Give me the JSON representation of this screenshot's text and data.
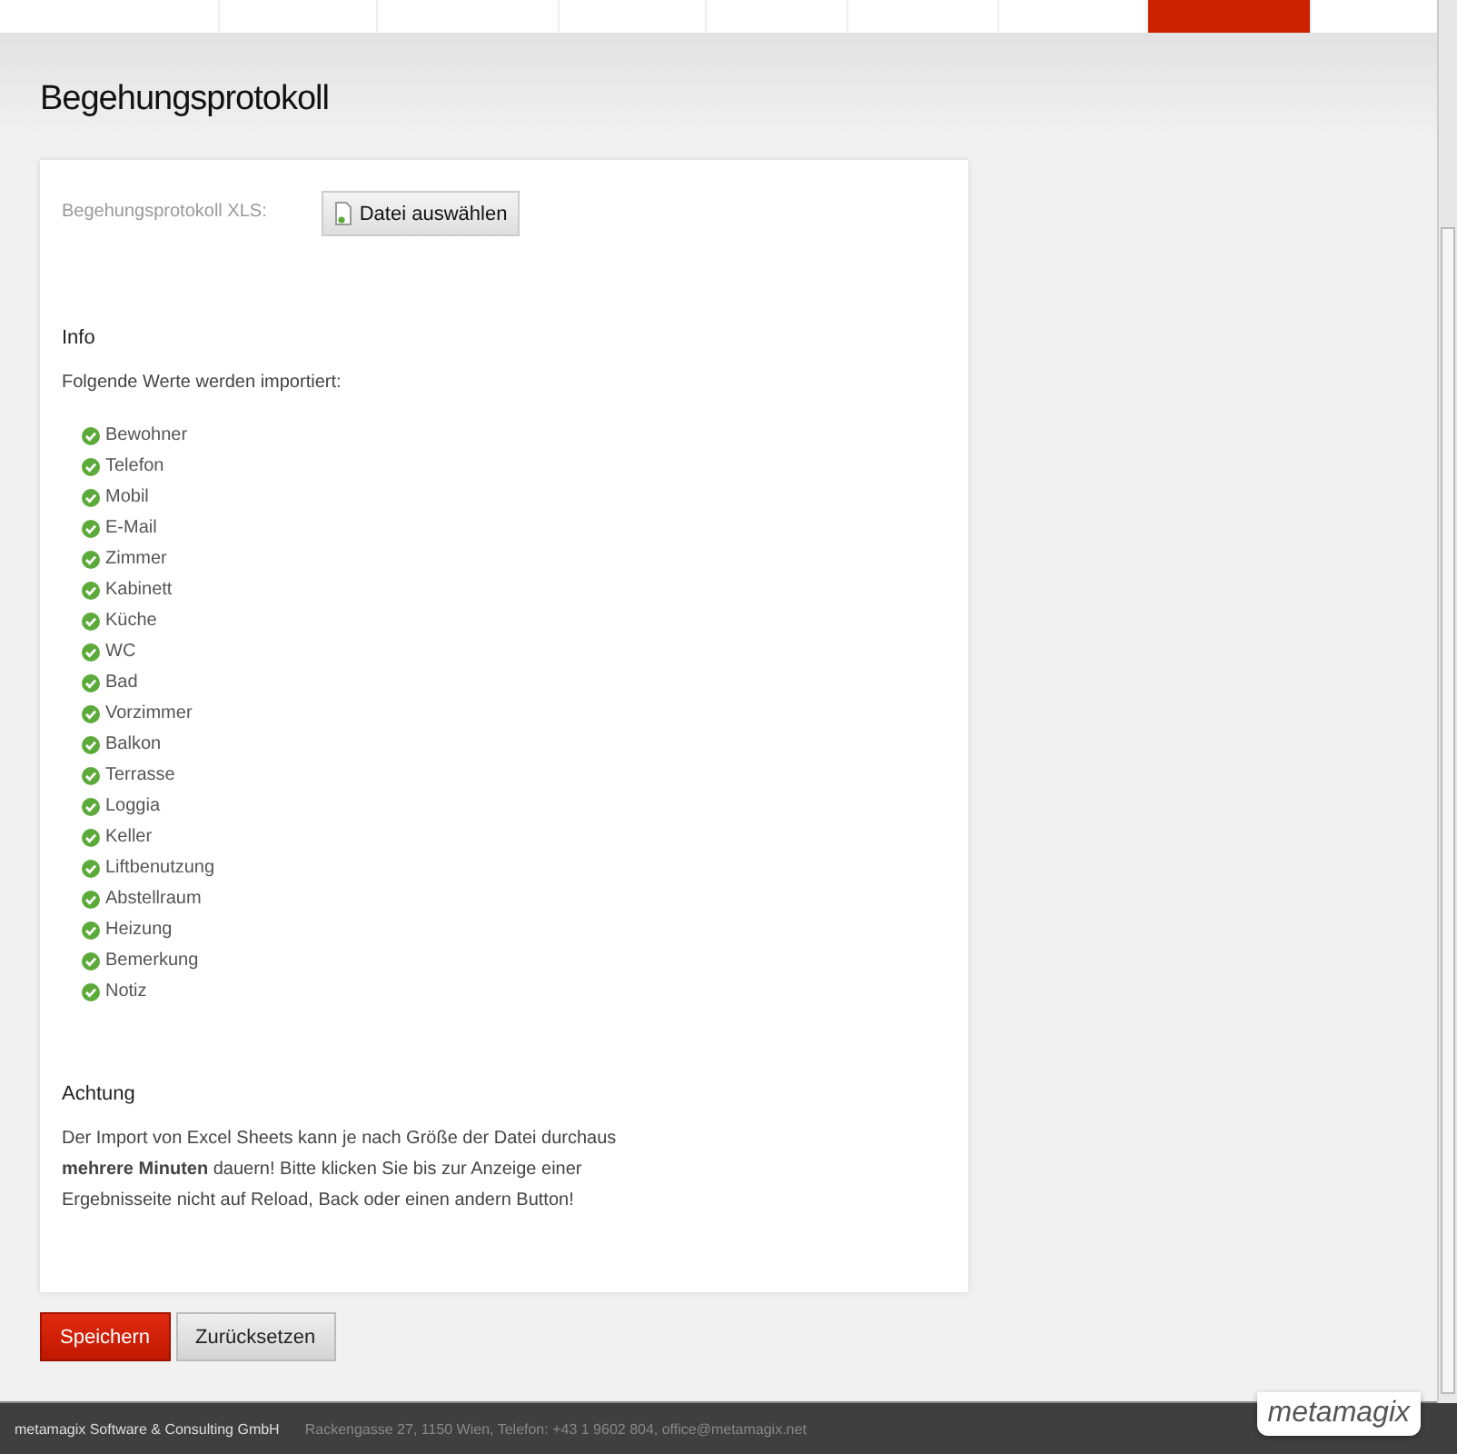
{
  "nav_tabs": [
    {
      "selected": false
    },
    {
      "selected": false
    },
    {
      "selected": false
    },
    {
      "selected": false
    },
    {
      "selected": false
    },
    {
      "selected": false
    },
    {
      "selected": false
    },
    {
      "selected": true
    }
  ],
  "page_title": "Begehungsprotokoll",
  "upload": {
    "label": "Begehungsprotokoll XLS:",
    "button": "Datei auswählen"
  },
  "info": {
    "heading": "Info",
    "intro": "Folgende Werte werden importiert:",
    "items": [
      "Bewohner",
      "Telefon",
      "Mobil",
      "E-Mail",
      "Zimmer",
      "Kabinett",
      "Küche",
      "WC",
      "Bad",
      "Vorzimmer",
      "Balkon",
      "Terrasse",
      "Loggia",
      "Keller",
      "Liftbenutzung",
      "Abstellraum",
      "Heizung",
      "Bemerkung",
      "Notiz"
    ]
  },
  "warning": {
    "heading": "Achtung",
    "text": "Der Import von Excel Sheets kann je nach Größe der Datei durchaus **mehrere Minuten** dauern! Bitte klicken Sie bis zur Anzeige einer Ergebnisseite nicht auf Reload, Back oder einen andern Button!"
  },
  "buttons": [
    {
      "label": "Speichern",
      "kind": "primary"
    },
    {
      "label": "Zurücksetzen",
      "kind": "secondary"
    }
  ],
  "footer": {
    "company": "metamagix Software & Consulting GmbH",
    "address": "Rackengasse 27, 1150 Wien, Telefon: +43 1 9602 804, office@metamagix.net",
    "logo": "metamagix"
  }
}
